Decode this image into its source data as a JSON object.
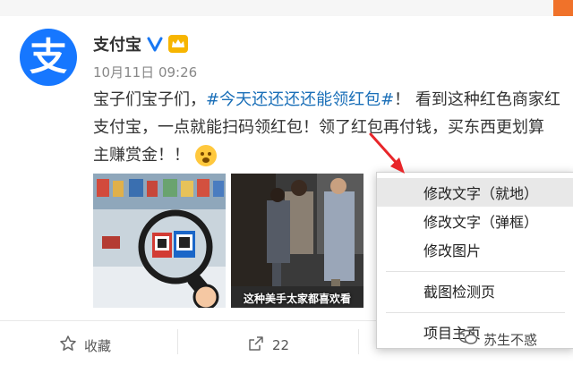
{
  "post": {
    "author": "支付宝",
    "author_initial": "支",
    "timestamp": "10月11日 09:26",
    "text_line1_before": "宝子们宝子们，",
    "hashtag": "#今天还还还还能领红包#",
    "text_line1_after": "！ 看到这种红色商家红",
    "text_line2": "支付宝，一点就能扫码领红包！领了红包再付钱，买东西更划算",
    "text_line3": "主赚赏金！！",
    "image2_caption": "这种美手太家都喜欢看"
  },
  "actions": {
    "favorite_label": "收藏",
    "share_count": "22"
  },
  "context_menu": {
    "items": [
      "修改文字（就地）",
      "修改文字（弹框）",
      "修改图片",
      "截图检测页",
      "项目主页"
    ]
  },
  "watermark": {
    "text": "苏生不惑"
  },
  "colors": {
    "brand_blue": "#1677ff",
    "hashtag": "#1a6fb8",
    "arrow_red": "#e8262a"
  }
}
